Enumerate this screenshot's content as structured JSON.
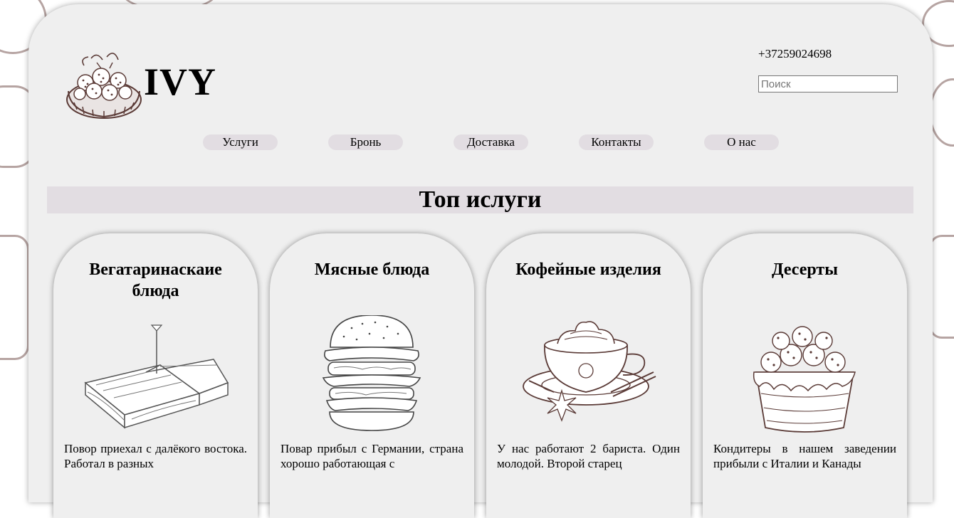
{
  "header": {
    "brand": "IVY",
    "phone": "+37259024698",
    "search_placeholder": "Поиск"
  },
  "nav": [
    {
      "label": "Услуги"
    },
    {
      "label": "Бронь"
    },
    {
      "label": "Доставка"
    },
    {
      "label": "Контакты"
    },
    {
      "label": "О нас"
    }
  ],
  "section": {
    "title": "Топ ислуги"
  },
  "cards": [
    {
      "title": "Вегатаринаскаие блюда",
      "text": "Повор приехал с далёкого востока. Работал в разных",
      "icon": "sandwich-icon"
    },
    {
      "title": "Мясные блюда",
      "text": "Повар прибыл с Германии, страна хорошо работающая с",
      "icon": "burger-icon"
    },
    {
      "title": "Кофейные изделия",
      "text": "У нас работают 2 бариста. Один молодой. Второй старец",
      "icon": "coffee-cup-icon"
    },
    {
      "title": "Десерты",
      "text": "Кондитеры в нашем заведении прибыли с Италии и Канады",
      "icon": "cake-icon"
    }
  ],
  "colors": {
    "page_bg": "#efefef",
    "accent": "#e2dde2",
    "sketch": "#6b4a45"
  }
}
